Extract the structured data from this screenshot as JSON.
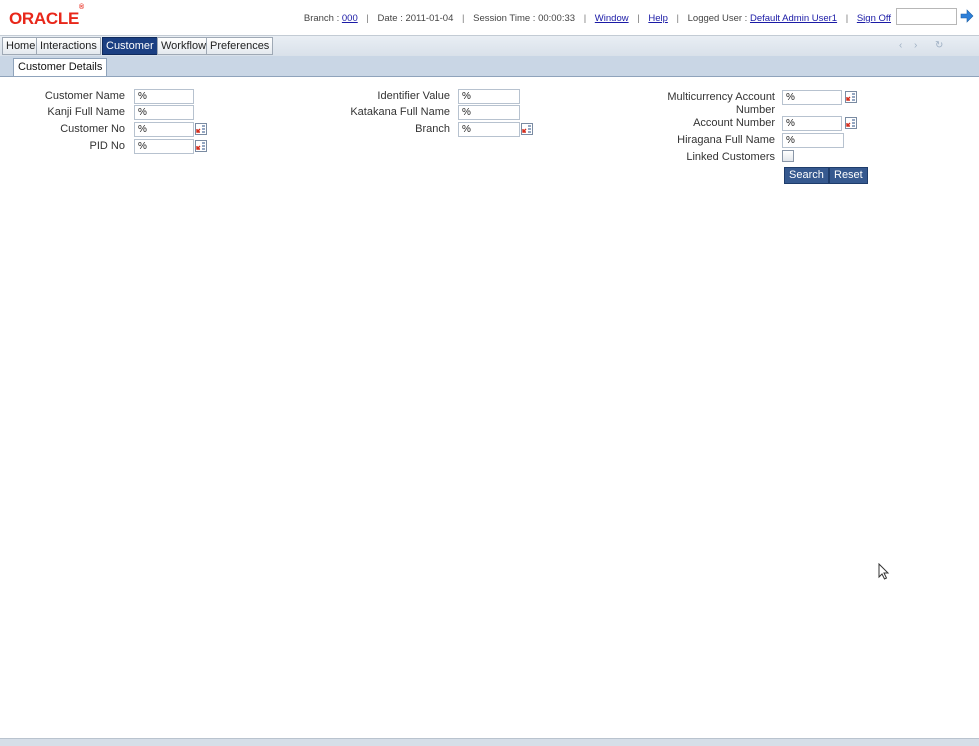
{
  "header": {
    "logo_text": "ORACLE",
    "branch_label": "Branch :",
    "branch_value": "000",
    "date_label": "Date : 2011-01-04",
    "session_label": "Session Time : 00:00:33",
    "window_link": "Window",
    "help_link": "Help",
    "logged_user_label": "Logged User :",
    "logged_user_value": "Default Admin User1",
    "signoff_link": "Sign Off",
    "function_input_value": "",
    "icons": {
      "go": "arrow-right-icon"
    }
  },
  "menu": {
    "items": [
      {
        "label": "Home"
      },
      {
        "label": "Interactions"
      },
      {
        "label": "Customer"
      },
      {
        "label": "Workflow"
      },
      {
        "label": "Preferences"
      }
    ],
    "active": "Customer",
    "controls": {
      "prev": "‹",
      "next": "›",
      "refresh": "↻"
    }
  },
  "tabs": {
    "active_tab": "Customer Details"
  },
  "form": {
    "col1": {
      "customer_name_label": "Customer Name",
      "customer_name_value": "%",
      "kanji_label": "Kanji Full Name",
      "kanji_value": "%",
      "customer_no_label": "Customer No",
      "customer_no_value": "%",
      "pid_no_label": "PID No",
      "pid_no_value": "%"
    },
    "col2": {
      "identifier_label": "Identifier Value",
      "identifier_value": "%",
      "katakana_label": "Katakana Full Name",
      "katakana_value": "%",
      "branch_label": "Branch",
      "branch_value": "%"
    },
    "col3": {
      "multicurrency_label_line1": "Multicurrency Account",
      "multicurrency_label_line2": "Number",
      "multicurrency_value": "%",
      "account_number_label": "Account Number",
      "account_number_value": "%",
      "hiragana_label": "Hiragana Full Name",
      "hiragana_value": "%",
      "linked_customers_label": "Linked Customers",
      "linked_customers_checked": false
    },
    "search_button": "Search",
    "reset_button": "Reset"
  },
  "colors": {
    "logo": "#e8271a",
    "active_menu": "#1b3f82",
    "button": "#36598f",
    "tabstrip": "#c9d6e5"
  }
}
